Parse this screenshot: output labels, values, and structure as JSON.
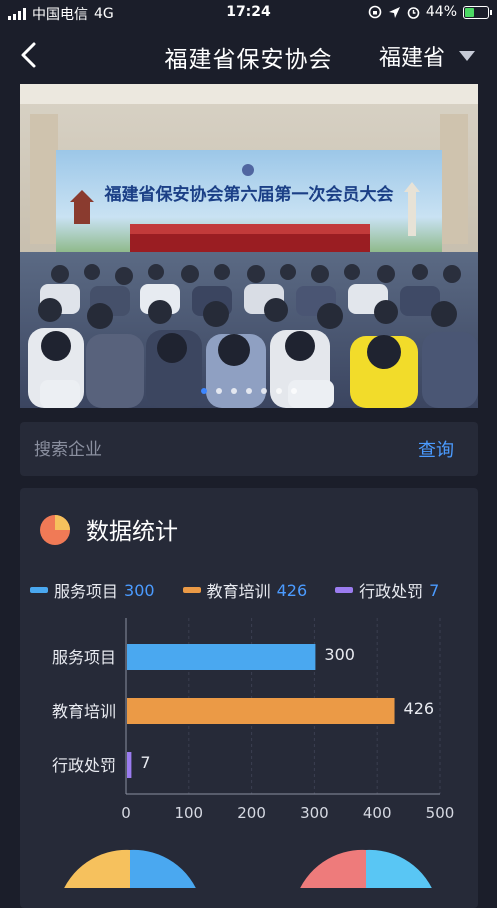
{
  "status_bar": {
    "carrier": "中国电信",
    "network": "4G",
    "time": "17:24",
    "battery": "44%"
  },
  "nav": {
    "title": "福建省保安协会",
    "region": "福建省"
  },
  "banner": {
    "slide_count": 7,
    "active_index": 0,
    "backdrop_text": "福建省保安协会第六届第一次会员大会"
  },
  "search": {
    "placeholder": "搜索企业",
    "button": "查询"
  },
  "stats": {
    "title": "数据统计",
    "legend": [
      {
        "label": "服务项目",
        "value": "300",
        "color": "#4aa8f0"
      },
      {
        "label": "教育培训",
        "value": "426",
        "color": "#eb9a46"
      },
      {
        "label": "行政处罚",
        "value": "7",
        "color": "#9b7cf0"
      }
    ]
  },
  "chart_data": {
    "type": "bar",
    "orientation": "horizontal",
    "categories": [
      "服务项目",
      "教育培训",
      "行政处罚"
    ],
    "values": [
      300,
      426,
      7
    ],
    "colors": [
      "#4aa8f0",
      "#eb9a46",
      "#9b7cf0"
    ],
    "xlim": [
      0,
      500
    ],
    "xticks": [
      0,
      100,
      200,
      300,
      400,
      500
    ],
    "xlabel": "",
    "ylabel": ""
  }
}
